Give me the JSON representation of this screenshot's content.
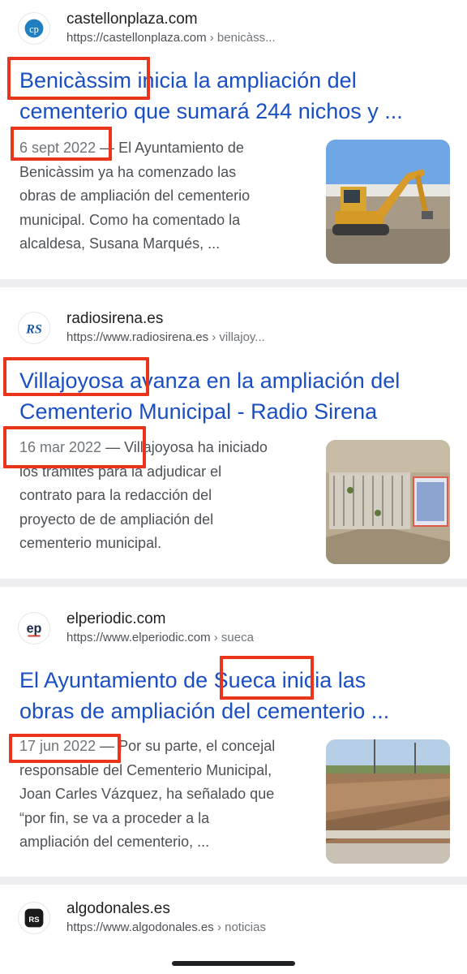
{
  "results": [
    {
      "site_name": "castellonplaza.com",
      "url": "https://castellonplaza.com",
      "crumb": " › benicàss...",
      "favicon": "cp",
      "title_line1": "Benicàssim inicia la ampliación del",
      "title_line2": "cementerio que sumará 244 nichos y ...",
      "date": "6 sept 2022",
      "snippet_l1": " — El Ayuntamiento de",
      "snippet_l2": "Benicàssim ya ha comenzado las",
      "snippet_l3": "obras de ampliación del cementerio",
      "snippet_l4": "municipal. Como ha comentado la",
      "snippet_l5": "alcaldesa, Susana Marqués, ...",
      "thumb_icon": "excavator-photo"
    },
    {
      "site_name": "radiosirena.es",
      "url": "https://www.radiosirena.es",
      "crumb": " › villajoy...",
      "favicon": "RS",
      "title_line1": "Villajoyosa avanza en la ampliación del",
      "title_line2": "Cementerio Municipal - Radio Sirena",
      "date": "16 mar 2022",
      "snippet_l1": " — Villajoyosa ha iniciado",
      "snippet_l2": "los trámites para la adjudicar el",
      "snippet_l3": "contrato para la redacción del",
      "snippet_l4": "proyecto de de ampliación del",
      "snippet_l5": "cementerio municipal.",
      "thumb_icon": "aerial-photo"
    },
    {
      "site_name": "elperiodic.com",
      "url": "https://www.elperiodic.com",
      "crumb": " › sueca",
      "favicon": "ep",
      "title_line1": "El Ayuntamiento de Sueca inicia las",
      "title_line2": "obras de ampliación del cementerio ...",
      "date": "17 jun 2022",
      "snippet_l1": " — Por su parte, el concejal",
      "snippet_l2": "responsable del Cementerio Municipal,",
      "snippet_l3": "Joan Carles Vázquez, ha señalado que",
      "snippet_l4": "“por fin, se va a proceder a la",
      "snippet_l5": "ampliación del cementerio, ...",
      "thumb_icon": "construction-trench-photo"
    },
    {
      "site_name": "algodonales.es",
      "url": "https://www.algodonales.es",
      "crumb": " › noticias",
      "favicon": "RS"
    }
  ],
  "colors": {
    "highlight_box": "#e8351c",
    "title_link": "#1a4fc4",
    "separator": "#eeeef0"
  }
}
